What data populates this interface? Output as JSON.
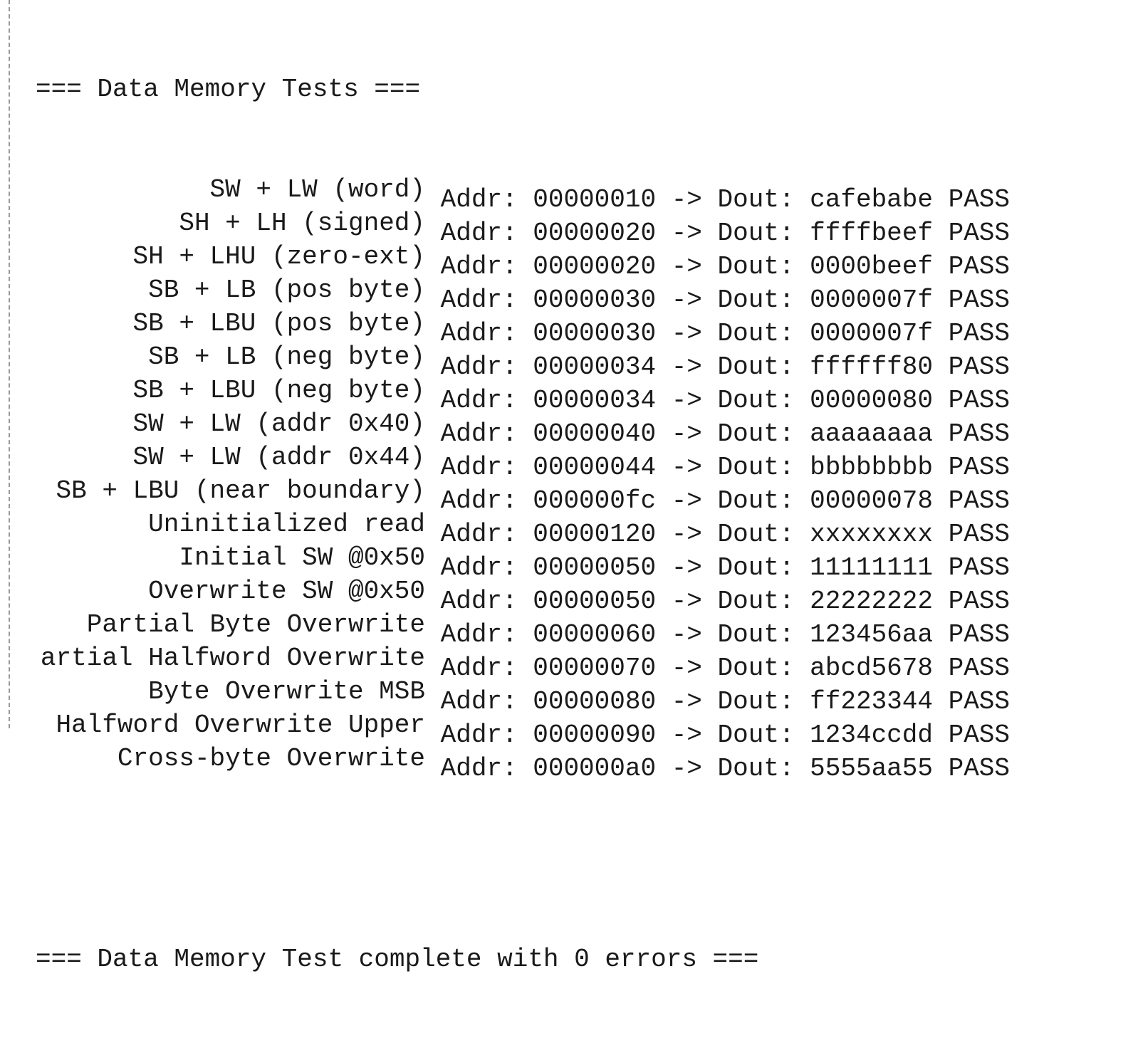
{
  "header": "=== Data Memory Tests ===",
  "rows": [
    {
      "label": "SW + LW (word)",
      "addr_label": "Addr:",
      "addr": "00000010",
      "arrow": "->",
      "dout_label": "Dout:",
      "dout": "cafebabe",
      "status": "PASS"
    },
    {
      "label": "SH + LH (signed)",
      "addr_label": "Addr:",
      "addr": "00000020",
      "arrow": "->",
      "dout_label": "Dout:",
      "dout": "ffffbeef",
      "status": "PASS"
    },
    {
      "label": "SH + LHU (zero-ext)",
      "addr_label": "Addr:",
      "addr": "00000020",
      "arrow": "->",
      "dout_label": "Dout:",
      "dout": "0000beef",
      "status": "PASS"
    },
    {
      "label": "SB + LB (pos byte)",
      "addr_label": "Addr:",
      "addr": "00000030",
      "arrow": "->",
      "dout_label": "Dout:",
      "dout": "0000007f",
      "status": "PASS"
    },
    {
      "label": "SB + LBU (pos byte)",
      "addr_label": "Addr:",
      "addr": "00000030",
      "arrow": "->",
      "dout_label": "Dout:",
      "dout": "0000007f",
      "status": "PASS"
    },
    {
      "label": "SB + LB (neg byte)",
      "addr_label": "Addr:",
      "addr": "00000034",
      "arrow": "->",
      "dout_label": "Dout:",
      "dout": "ffffff80",
      "status": "PASS"
    },
    {
      "label": "SB + LBU (neg byte)",
      "addr_label": "Addr:",
      "addr": "00000034",
      "arrow": "->",
      "dout_label": "Dout:",
      "dout": "00000080",
      "status": "PASS"
    },
    {
      "label": "SW + LW (addr 0x40)",
      "addr_label": "Addr:",
      "addr": "00000040",
      "arrow": "->",
      "dout_label": "Dout:",
      "dout": "aaaaaaaa",
      "status": "PASS"
    },
    {
      "label": "SW + LW (addr 0x44)",
      "addr_label": "Addr:",
      "addr": "00000044",
      "arrow": "->",
      "dout_label": "Dout:",
      "dout": "bbbbbbbb",
      "status": "PASS"
    },
    {
      "label": "SB + LBU (near boundary)",
      "addr_label": "Addr:",
      "addr": "000000fc",
      "arrow": "->",
      "dout_label": "Dout:",
      "dout": "00000078",
      "status": "PASS"
    },
    {
      "label": "Uninitialized read",
      "addr_label": "Addr:",
      "addr": "00000120",
      "arrow": "->",
      "dout_label": "Dout:",
      "dout": "xxxxxxxx",
      "status": "PASS"
    },
    {
      "label": "Initial SW @0x50",
      "addr_label": "Addr:",
      "addr": "00000050",
      "arrow": "->",
      "dout_label": "Dout:",
      "dout": "11111111",
      "status": "PASS"
    },
    {
      "label": "Overwrite SW @0x50",
      "addr_label": "Addr:",
      "addr": "00000050",
      "arrow": "->",
      "dout_label": "Dout:",
      "dout": "22222222",
      "status": "PASS"
    },
    {
      "label": "Partial Byte Overwrite",
      "addr_label": "Addr:",
      "addr": "00000060",
      "arrow": "->",
      "dout_label": "Dout:",
      "dout": "123456aa",
      "status": "PASS"
    },
    {
      "label": "artial Halfword Overwrite",
      "addr_label": "Addr:",
      "addr": "00000070",
      "arrow": "->",
      "dout_label": "Dout:",
      "dout": "abcd5678",
      "status": "PASS"
    },
    {
      "label": "Byte Overwrite MSB",
      "addr_label": "Addr:",
      "addr": "00000080",
      "arrow": "->",
      "dout_label": "Dout:",
      "dout": "ff223344",
      "status": "PASS"
    },
    {
      "label": "Halfword Overwrite Upper",
      "addr_label": "Addr:",
      "addr": "00000090",
      "arrow": "->",
      "dout_label": "Dout:",
      "dout": "1234ccdd",
      "status": "PASS"
    },
    {
      "label": "Cross-byte Overwrite",
      "addr_label": "Addr:",
      "addr": "000000a0",
      "arrow": "->",
      "dout_label": "Dout:",
      "dout": "5555aa55",
      "status": "PASS"
    }
  ],
  "footer": "=== Data Memory Test complete with 0 errors ==="
}
